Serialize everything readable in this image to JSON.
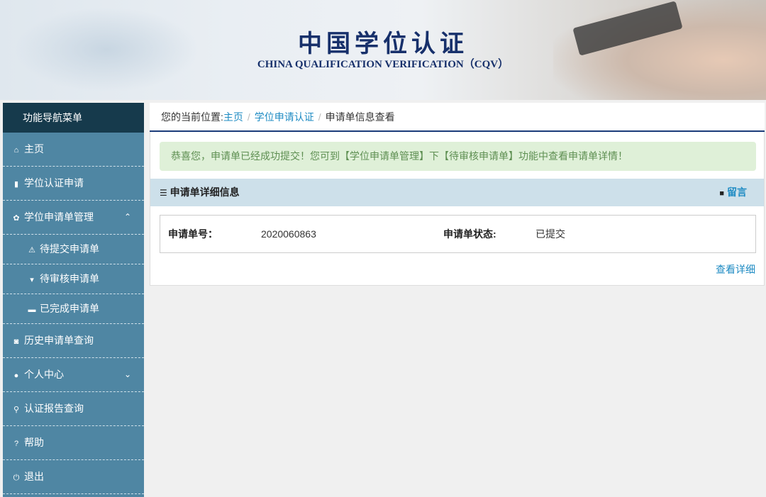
{
  "header": {
    "title": "中国学位认证",
    "subtitle": "CHINA QUALIFICATION VERIFICATION（CQV）"
  },
  "sidebar": {
    "title": "功能导航菜单",
    "items": [
      {
        "label": "主页",
        "icon": "home-icon",
        "glyph": "⌂"
      },
      {
        "label": "学位认证申请",
        "icon": "file-icon",
        "glyph": "▮"
      },
      {
        "label": "学位申请单管理",
        "icon": "gear-icon",
        "glyph": "✿",
        "chevron": "⌃"
      },
      {
        "label": "待提交申请单",
        "icon": "warning-icon",
        "glyph": "⚠"
      },
      {
        "label": "待审核申请单",
        "icon": "cart-icon",
        "glyph": "▾"
      },
      {
        "label": "已完成申请单",
        "icon": "briefcase-icon",
        "glyph": "▬"
      },
      {
        "label": "历史申请单查询",
        "icon": "camera-icon",
        "glyph": "◙"
      },
      {
        "label": "个人中心",
        "icon": "user-icon",
        "glyph": "●",
        "chevron": "⌄"
      },
      {
        "label": "认证报告查询",
        "icon": "search-icon",
        "glyph": "⚲"
      },
      {
        "label": "帮助",
        "icon": "help-icon",
        "glyph": "?"
      },
      {
        "label": "退出",
        "icon": "power-icon",
        "glyph": "⏻"
      }
    ]
  },
  "breadcrumb": {
    "prefix": "您的当前位置:",
    "items": [
      "主页",
      "学位申请认证",
      "申请单信息查看"
    ],
    "sep": "/"
  },
  "alert": "恭喜您，申请单已经成功提交！您可到【学位申请单管理】下【待审核申请单】功能中查看申请单详情！",
  "panel": {
    "title": "申请单详细信息",
    "message_link": "留言",
    "number_label": "申请单号：",
    "number": "2020060863",
    "status_label": "申请单状态:",
    "status": "已提交",
    "detail_link": "查看详细"
  }
}
